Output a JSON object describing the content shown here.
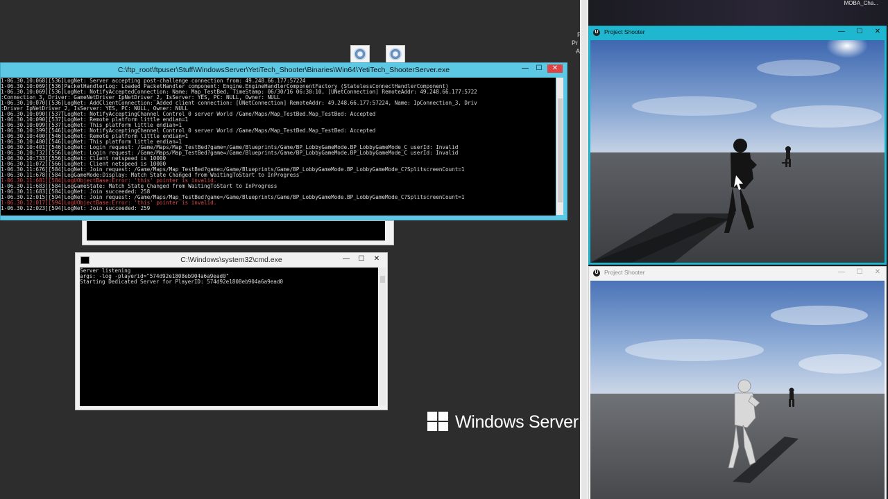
{
  "server_console": {
    "title": "C:\\ftp_root\\ftpuser\\Stuff\\WindowsServer\\YetiTech_Shooter\\Binaries\\Win64\\YetiTech_ShooterServer.exe",
    "lines": [
      {
        "text": "1-06.30.10:068][536]LogNet: Server accepting post-challenge connection from: 49.248.66.177:57224",
        "err": false
      },
      {
        "text": "1-06.30.10:069][536]PacketHandlerLog: Loaded PacketHandler component: Engine.EngineHandlerComponentFactory (StatelessConnectHandlerComponent)",
        "err": false
      },
      {
        "text": "1-06.30.10:069][536]LogNet: NotifyAcceptedConnection: Name: Map_TestBed, TimeStamp: 06/30/16 06:30:10, [UNetConnection] RemoteAddr: 49.248.66.177:5722",
        "err": false
      },
      {
        "text": ":Connection_3, Driver: GameNetDriver IpNetDriver_2, IsServer: YES, PC: NULL, Owner: NULL",
        "err": false
      },
      {
        "text": "1-06.30.10:070][536]LogNet: AddClientConnection: Added client connection: [UNetConnection] RemoteAddr: 49.248.66.177:57224, Name: IpConnection_3, Driv",
        "err": false
      },
      {
        "text": ":Driver IpNetDriver_2, IsServer: YES, PC: NULL, Owner: NULL",
        "err": false
      },
      {
        "text": "1-06.30.10:090][537]LogNet: NotifyAcceptingChannel Control 0 server World /Game/Maps/Map_TestBed.Map_TestBed: Accepted",
        "err": false
      },
      {
        "text": "1-06.30.10:090][537]LogNet: Remote platform little endian=1",
        "err": false
      },
      {
        "text": "1-06.30.10:099][537]LogNet: This platform little endian=1",
        "err": false
      },
      {
        "text": "1-06.30.10:399][546]LogNet: NotifyAcceptingChannel Control 0 server World /Game/Maps/Map_TestBed.Map_TestBed: Accepted",
        "err": false
      },
      {
        "text": "1-06.30.10:400][546]LogNet: Remote platform little endian=1",
        "err": false
      },
      {
        "text": "1-06.30.10:400][546]LogNet: This platform little endian=1",
        "err": false
      },
      {
        "text": "1-06.30.10:401][546]LogNet: Login request: /Game/Maps/Map_TestBed?game=/Game/Blueprints/Game/BP_LobbyGameMode.BP_LobbyGameMode_C userId: Invalid",
        "err": false
      },
      {
        "text": "1-06.30.10:732][556]LogNet: Login request: /Game/Maps/Map_TestBed?game=/Game/Blueprints/Game/BP_LobbyGameMode.BP_LobbyGameMode_C userId: Invalid",
        "err": false
      },
      {
        "text": "1-06.30.10:733][556]LogNet: Client netspeed is 10000",
        "err": false
      },
      {
        "text": "1-06.30.11:072][566]LogNet: Client netspeed is 10000",
        "err": false
      },
      {
        "text": "1-06.30.11:676][584]LogNet: Join request: /Game/Maps/Map_TestBed?game=/Game/Blueprints/Game/BP_LobbyGameMode.BP_LobbyGameMode_C?SplitscreenCount=1",
        "err": false
      },
      {
        "text": "1-06.30.11:678][584]LogGameMode:Display: Match State Changed from WaitingToStart to InProgress",
        "err": false
      },
      {
        "text": "1-06.30.11:681][584]LogUObjectBase:Error: 'this' pointer is invalid.",
        "err": true
      },
      {
        "text": "1-06.30.11:683][584]LogGameState: Match State Changed from WaitingToStart to InProgress",
        "err": false
      },
      {
        "text": "1-06.30.11:683][584]LogNet: Join succeeded: 258",
        "err": false
      },
      {
        "text": "1-06.30.12:015][594]LogNet: Join request: /Game/Maps/Map_TestBed?game=/Game/Blueprints/Game/BP_LobbyGameMode.BP_LobbyGameMode_C?SplitscreenCount=1",
        "err": false
      },
      {
        "text": "1-06.30.12:017][594]LogUObjectBase:Error: 'this' pointer is invalid.",
        "err": true
      },
      {
        "text": "1-06.30.12:023][594]LogNet: Join succeeded: 259",
        "err": false
      }
    ]
  },
  "cmd_window": {
    "title": "C:\\Windows\\system32\\cmd.exe",
    "lines": [
      {
        "text": "Server listening",
        "err": false
      },
      {
        "text": "args: -log -playerid=\"574d92e1808eb904a6a9ead0\"",
        "err": false
      },
      {
        "text": "Starting Dedicated Server for PlayerID: 574d92e1808eb904a6a9ead0",
        "err": false
      }
    ]
  },
  "window_controls": {
    "minimize": "—",
    "maximize": "☐",
    "close": "✕"
  },
  "branding": {
    "os_name": "Windows Server"
  },
  "side_text": [
    "P",
    "Pr",
    "A"
  ],
  "taskbar": {
    "label": "MOBA_Cha..."
  },
  "game_windows": [
    {
      "title": "Project Shooter",
      "active": true,
      "logo": "U"
    },
    {
      "title": "Project Shooter",
      "active": false,
      "logo": "U"
    }
  ],
  "colors": {
    "console_bg": "#000000",
    "console_error": "#e04848",
    "server_title": "#5cc8e4",
    "game_active_title": "#1fb6cf"
  }
}
